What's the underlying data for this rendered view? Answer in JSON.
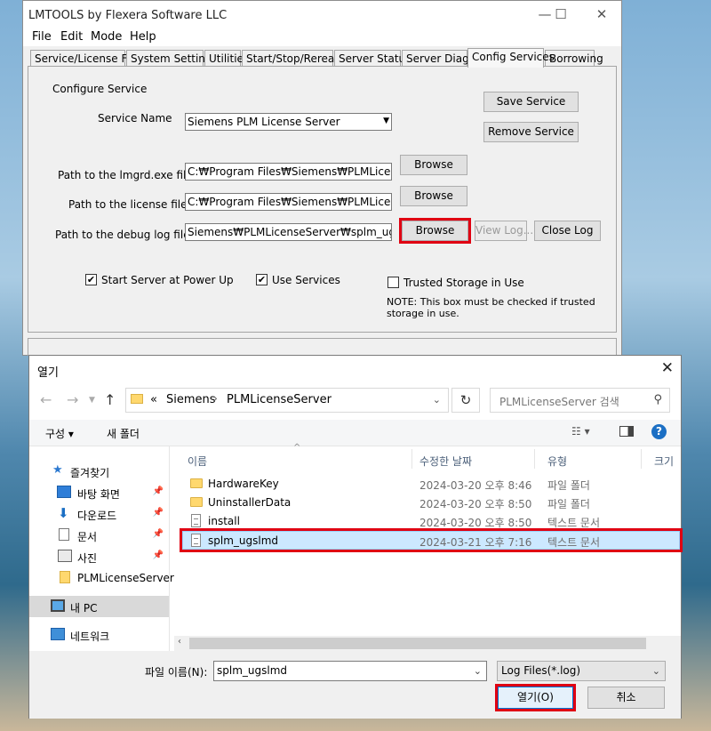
{
  "lmtools": {
    "title": "LMTOOLS by Flexera Software LLC",
    "window_controls": {
      "minimize": "—",
      "maximize": "☐",
      "close": "✕"
    },
    "menu": [
      "File",
      "Edit",
      "Mode",
      "Help"
    ],
    "tabs": [
      "Service/License File",
      "System Settings",
      "Utilities",
      "Start/Stop/Reread",
      "Server Status",
      "Server Diags",
      "Config Services",
      "Borrowing"
    ],
    "active_tab": "Config Services",
    "config": {
      "section_label": "Configure Service",
      "service_name_label": "Service Name",
      "service_name_value": "Siemens PLM License Server",
      "lmgrd_label": "Path to the lmgrd.exe file",
      "lmgrd_value": "C:₩Program Files₩Siemens₩PLMLicenseServ",
      "license_label": "Path to the license file",
      "license_value": "C:₩Program Files₩Siemens₩PLMLicenseServ",
      "debuglog_label": "Path to the debug log file",
      "debuglog_value": "Siemens₩PLMLicenseServer₩splm_ugslmd.log",
      "browse_label": "Browse",
      "save_service": "Save Service",
      "remove_service": "Remove Service",
      "view_log": "View Log...",
      "close_log": "Close Log",
      "start_at_powerup": "Start Server at Power Up",
      "use_services": "Use Services",
      "trusted_storage": "Trusted Storage in Use",
      "note": "NOTE: This box must be checked if trusted storage in use."
    },
    "checks": {
      "start_at_powerup": true,
      "use_services": true,
      "trusted_storage": false
    }
  },
  "dialog": {
    "title": "열기",
    "close": "✕",
    "path_prefix": "«",
    "path": [
      "Siemens",
      "PLMLicenseServer"
    ],
    "search_placeholder": "PLMLicenseServer 검색",
    "organize": "구성 ▾",
    "new_folder": "새 폴더",
    "nav": [
      {
        "label": "즐겨찾기",
        "icon": "star-icon"
      },
      {
        "label": "바탕 화면",
        "icon": "desktop-icon",
        "pinned": true
      },
      {
        "label": "다운로드",
        "icon": "download-icon",
        "pinned": true
      },
      {
        "label": "문서",
        "icon": "document-icon",
        "pinned": true
      },
      {
        "label": "사진",
        "icon": "picture-icon",
        "pinned": true
      },
      {
        "label": "PLMLicenseServer",
        "icon": "folder-icon"
      },
      {
        "label": "내 PC",
        "icon": "computer-icon",
        "selected": true
      },
      {
        "label": "네트워크",
        "icon": "network-icon"
      }
    ],
    "columns": {
      "name": "이름",
      "date": "수정한 날짜",
      "type": "유형",
      "size": "크기"
    },
    "files": [
      {
        "name": "HardwareKey",
        "date": "2024-03-20 오후 8:46",
        "type": "파일 폴더",
        "kind": "folder"
      },
      {
        "name": "UninstallerData",
        "date": "2024-03-20 오후 8:50",
        "type": "파일 폴더",
        "kind": "folder"
      },
      {
        "name": "install",
        "date": "2024-03-20 오후 8:50",
        "type": "텍스트 문서",
        "kind": "doc"
      },
      {
        "name": "splm_ugslmd",
        "date": "2024-03-21 오후 7:16",
        "type": "텍스트 문서",
        "kind": "doc",
        "selected": true
      }
    ],
    "filename_label": "파일 이름(N):",
    "filename_value": "splm_ugslmd",
    "filetype_value": "Log Files(*.log)",
    "open_button": "열기(O)",
    "cancel_button": "취소"
  },
  "colors": {
    "highlight": "#e00012",
    "selection": "#cce8ff",
    "link": "#4c607a"
  }
}
